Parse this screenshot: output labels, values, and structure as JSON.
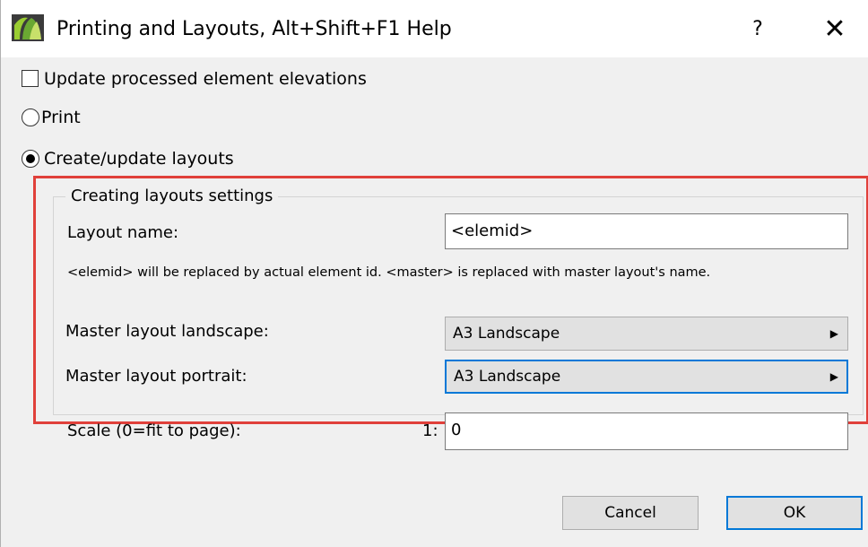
{
  "window": {
    "title": "Printing and Layouts, Alt+Shift+F1 Help",
    "help_glyph": "?",
    "close_glyph": "✕",
    "app_icon": "archicad-logo-icon"
  },
  "options": {
    "update_elevations": {
      "label": "Update processed element elevations",
      "checked": false
    },
    "print": {
      "label": "Print",
      "selected": false
    },
    "create_layouts": {
      "label": "Create/update layouts",
      "selected": true
    }
  },
  "layout_settings": {
    "group_title": "Creating layouts settings",
    "layout_name_label": "Layout name:",
    "layout_name_value": "<elemid>",
    "note": "<elemid> will be replaced by actual element id. <master> is replaced with master layout's name.",
    "master_landscape_label": "Master layout landscape:",
    "master_landscape_value": "A3 Landscape",
    "master_portrait_label": "Master layout portrait:",
    "master_portrait_value": "A3 Landscape",
    "scale_label": "Scale (0=fit to page):",
    "scale_prefix": "1:",
    "scale_value": "0",
    "dropdown_arrow": "▶"
  },
  "buttons": {
    "cancel": "Cancel",
    "ok": "OK"
  },
  "colors": {
    "highlight": "#e0403a",
    "focus": "#0078d7"
  }
}
